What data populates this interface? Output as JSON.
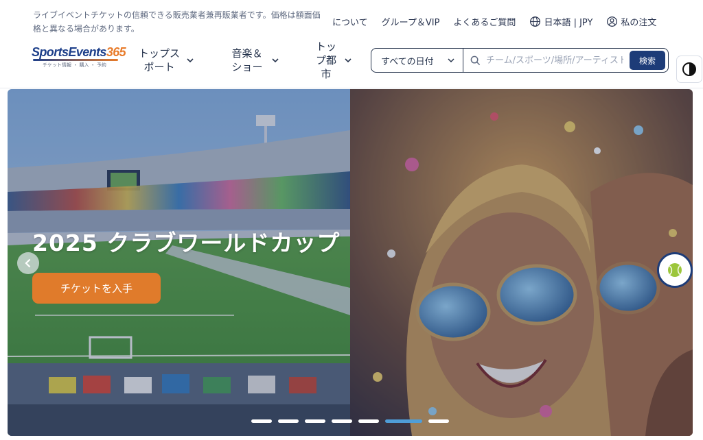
{
  "notice": "ライブイベントチケットの信頼できる販売業者兼再販業者です。価格は額面価格と異なる場合があります。",
  "top_links": {
    "about": "について",
    "groups_vip": "グループ＆VIP",
    "faq": "よくあるご質問",
    "language": "日本語 | JPY",
    "my_orders": "私の注文"
  },
  "logo": {
    "brand_main": "SportsEvents",
    "brand_number": "365",
    "tagline": "チケット情報 ・ 購入 ・ 予約"
  },
  "nav": {
    "top_sports": "トップス\nポート",
    "music_shows": "音楽＆\nショー",
    "top_cities": "トッ\nプ都\n市"
  },
  "search": {
    "date_select": "すべての日付",
    "placeholder": "チーム/スポーツ/場所/アーティスト",
    "button": "検索"
  },
  "hero": {
    "title": "2025 クラブワールドカップ",
    "cta": "チケットを入手",
    "slide_count": 7,
    "active_slide": 6
  },
  "colors": {
    "brand_navy": "#1d3c78",
    "cta_orange": "#e07b2b",
    "active_dot": "#4f9ed8"
  },
  "icons": {
    "language": "globe-icon",
    "orders": "user-icon",
    "search": "search-icon",
    "theme": "half-circle-icon",
    "prev": "chevron-left-icon",
    "chat": "tennis-ball-icon"
  }
}
